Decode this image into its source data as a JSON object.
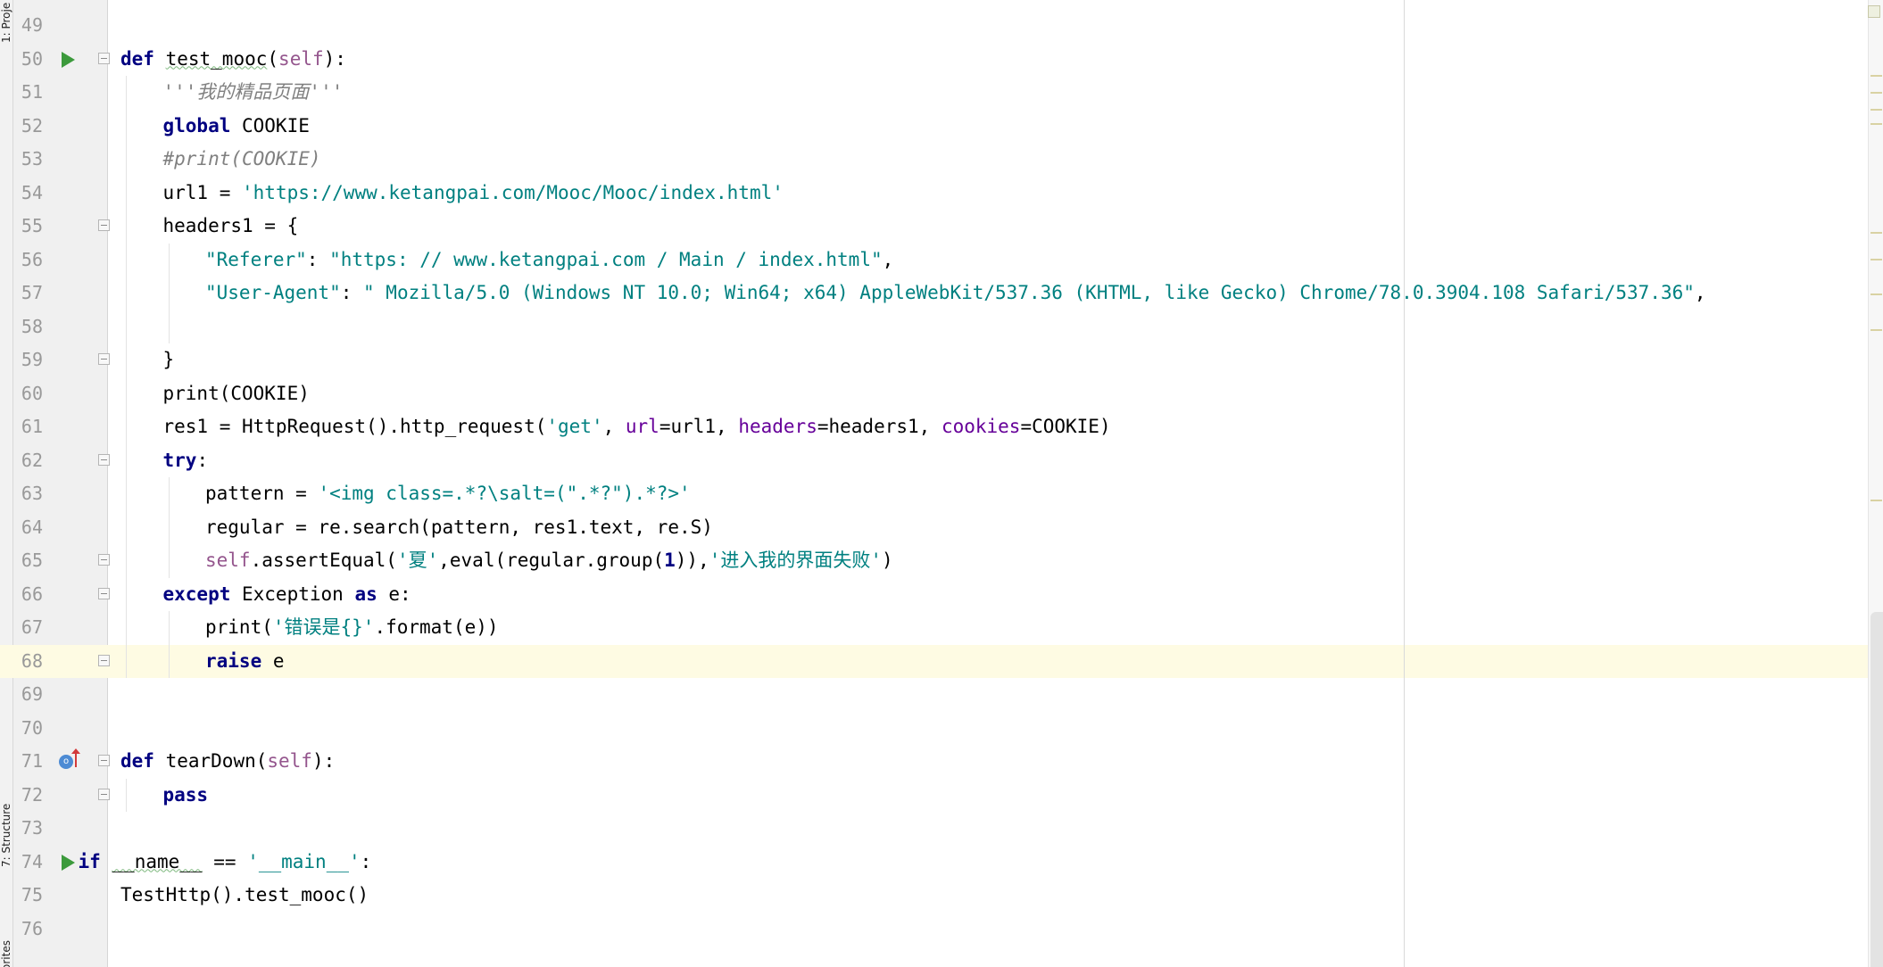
{
  "sidebar": {
    "tabs": [
      {
        "label": "1: Proje",
        "name": "tab-project"
      },
      {
        "label": "7: Structure",
        "name": "tab-structure"
      },
      {
        "label": "orites",
        "name": "tab-favorites"
      }
    ]
  },
  "colors": {
    "keyword": "#000080",
    "string": "#008080",
    "comment": "#808080",
    "self": "#94558d",
    "parameter": "#660099",
    "line_number": "#999999",
    "caret_row": "#fefbe3",
    "run_icon": "#3c9a3c"
  },
  "editor": {
    "lines": [
      {
        "no": "49",
        "indent": 0,
        "tokens": []
      },
      {
        "no": "50",
        "indent": 1,
        "icon": "run",
        "fold": true,
        "tokens": [
          {
            "t": "def",
            "c": "kw"
          },
          {
            "t": " "
          },
          {
            "t": "test_mooc",
            "c": "typo"
          },
          {
            "t": "("
          },
          {
            "t": "self",
            "c": "slf"
          },
          {
            "t": "):"
          }
        ]
      },
      {
        "no": "51",
        "indent": 2,
        "tokens": [
          {
            "t": "'''我的精品页面'''",
            "c": "doc"
          }
        ]
      },
      {
        "no": "52",
        "indent": 2,
        "tokens": [
          {
            "t": "global",
            "c": "kw"
          },
          {
            "t": " COOKIE"
          }
        ]
      },
      {
        "no": "53",
        "indent": 2,
        "tokens": [
          {
            "t": "#print(COOKIE)",
            "c": "cmt"
          }
        ]
      },
      {
        "no": "54",
        "indent": 2,
        "tokens": [
          {
            "t": "url1 = "
          },
          {
            "t": "'https://www.ketangpai.com/Mooc/Mooc/index.html'",
            "c": "str"
          }
        ]
      },
      {
        "no": "55",
        "indent": 2,
        "fold": true,
        "tokens": [
          {
            "t": "headers1 = {"
          }
        ]
      },
      {
        "no": "56",
        "indent": 3,
        "tokens": [
          {
            "t": "\"Referer\"",
            "c": "str"
          },
          {
            "t": ": "
          },
          {
            "t": "\"https: // www.ketangpai.com / Main / index.html\"",
            "c": "str"
          },
          {
            "t": ","
          }
        ]
      },
      {
        "no": "57",
        "indent": 3,
        "tokens": [
          {
            "t": "\"User-Agent\"",
            "c": "str"
          },
          {
            "t": ": "
          },
          {
            "t": "\" Mozilla/5.0 (Windows NT 10.0; Win64; x64) AppleWebKit/537.36 (KHTML, like Gecko) Chrome/78.0.3904.108 Safari/537.36\"",
            "c": "str"
          },
          {
            "t": ","
          }
        ]
      },
      {
        "no": "58",
        "indent": 3,
        "tokens": []
      },
      {
        "no": "59",
        "indent": 2,
        "fold": true,
        "tokens": [
          {
            "t": "}"
          }
        ]
      },
      {
        "no": "60",
        "indent": 2,
        "tokens": [
          {
            "t": "print(COOKIE)"
          }
        ]
      },
      {
        "no": "61",
        "indent": 2,
        "tokens": [
          {
            "t": "res1 = HttpRequest().http_request("
          },
          {
            "t": "'get'",
            "c": "str"
          },
          {
            "t": ", "
          },
          {
            "t": "url",
            "c": "par"
          },
          {
            "t": "=url1, "
          },
          {
            "t": "headers",
            "c": "par"
          },
          {
            "t": "=headers1, "
          },
          {
            "t": "cookies",
            "c": "par"
          },
          {
            "t": "=COOKIE)"
          }
        ]
      },
      {
        "no": "62",
        "indent": 2,
        "fold": true,
        "tokens": [
          {
            "t": "try",
            "c": "kw"
          },
          {
            "t": ":"
          }
        ]
      },
      {
        "no": "63",
        "indent": 3,
        "tokens": [
          {
            "t": "pattern = "
          },
          {
            "t": "'<img class=.*?\\salt=(\".*?\").*?>'",
            "c": "str"
          }
        ]
      },
      {
        "no": "64",
        "indent": 3,
        "tokens": [
          {
            "t": "regular = re.search(pattern, res1.text, re.S)"
          }
        ]
      },
      {
        "no": "65",
        "indent": 3,
        "fold": true,
        "tokens": [
          {
            "t": "self",
            "c": "slf"
          },
          {
            "t": ".assertEqual("
          },
          {
            "t": "'夏'",
            "c": "str"
          },
          {
            "t": ",eval(regular.group("
          },
          {
            "t": "1",
            "c": "kw"
          },
          {
            "t": ")),"
          },
          {
            "t": "'进入我的界面失败'",
            "c": "str"
          },
          {
            "t": ")"
          }
        ]
      },
      {
        "no": "66",
        "indent": 2,
        "fold": true,
        "tokens": [
          {
            "t": "except",
            "c": "kw"
          },
          {
            "t": " Exception "
          },
          {
            "t": "as",
            "c": "kw"
          },
          {
            "t": " e:"
          }
        ]
      },
      {
        "no": "67",
        "indent": 3,
        "tokens": [
          {
            "t": "print("
          },
          {
            "t": "'错误是{}'",
            "c": "str"
          },
          {
            "t": ".format(e))"
          }
        ]
      },
      {
        "no": "68",
        "indent": 3,
        "fold": true,
        "caret": true,
        "tokens": [
          {
            "t": "raise",
            "c": "kw"
          },
          {
            "t": " e"
          }
        ]
      },
      {
        "no": "69",
        "indent": 0,
        "tokens": []
      },
      {
        "no": "70",
        "indent": 0,
        "tokens": []
      },
      {
        "no": "71",
        "indent": 1,
        "icon": "override",
        "fold": true,
        "tokens": [
          {
            "t": "def",
            "c": "kw"
          },
          {
            "t": " tearDown("
          },
          {
            "t": "self",
            "c": "slf"
          },
          {
            "t": "):"
          }
        ]
      },
      {
        "no": "72",
        "indent": 2,
        "fold": true,
        "tokens": [
          {
            "t": "pass",
            "c": "kw"
          }
        ]
      },
      {
        "no": "73",
        "indent": 0,
        "tokens": []
      },
      {
        "no": "74",
        "indent": 0,
        "icon": "run",
        "tokens": [
          {
            "t": "if",
            "c": "kw"
          },
          {
            "t": " "
          },
          {
            "t": "__name__",
            "c": "typo"
          },
          {
            "t": " == "
          },
          {
            "t": "'__main__'",
            "c": "str"
          },
          {
            "t": ":"
          }
        ]
      },
      {
        "no": "75",
        "indent": 1,
        "tokens": [
          {
            "t": "TestHttp().test_mooc()"
          }
        ]
      },
      {
        "no": "76",
        "indent": 0,
        "tokens": []
      }
    ]
  }
}
